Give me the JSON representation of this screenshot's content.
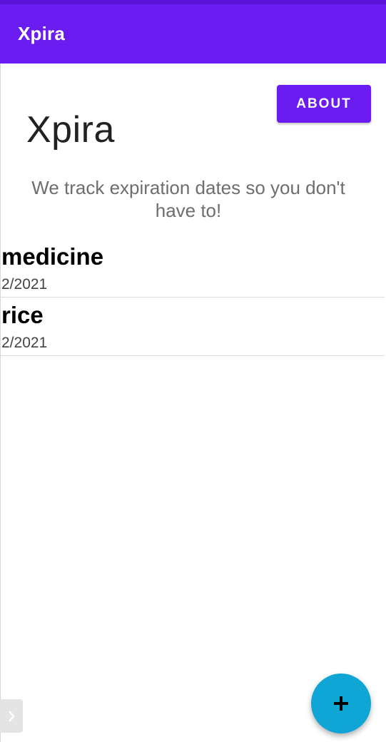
{
  "app_bar": {
    "title": "Xpira"
  },
  "header": {
    "about_label": "ABOUT",
    "title": "Xpira",
    "subtitle": "We track expiration dates so you don't have to!"
  },
  "items": [
    {
      "name": "medicine",
      "date": "2/2021"
    },
    {
      "name": "rice",
      "date": "2/2021"
    }
  ],
  "fab": {
    "icon": "plus-icon"
  },
  "side_handle": {
    "icon": "chevron-right-icon"
  },
  "colors": {
    "primary": "#6a1cf0",
    "status_bar": "#5a14d6",
    "fab": "#0fa6d6"
  }
}
